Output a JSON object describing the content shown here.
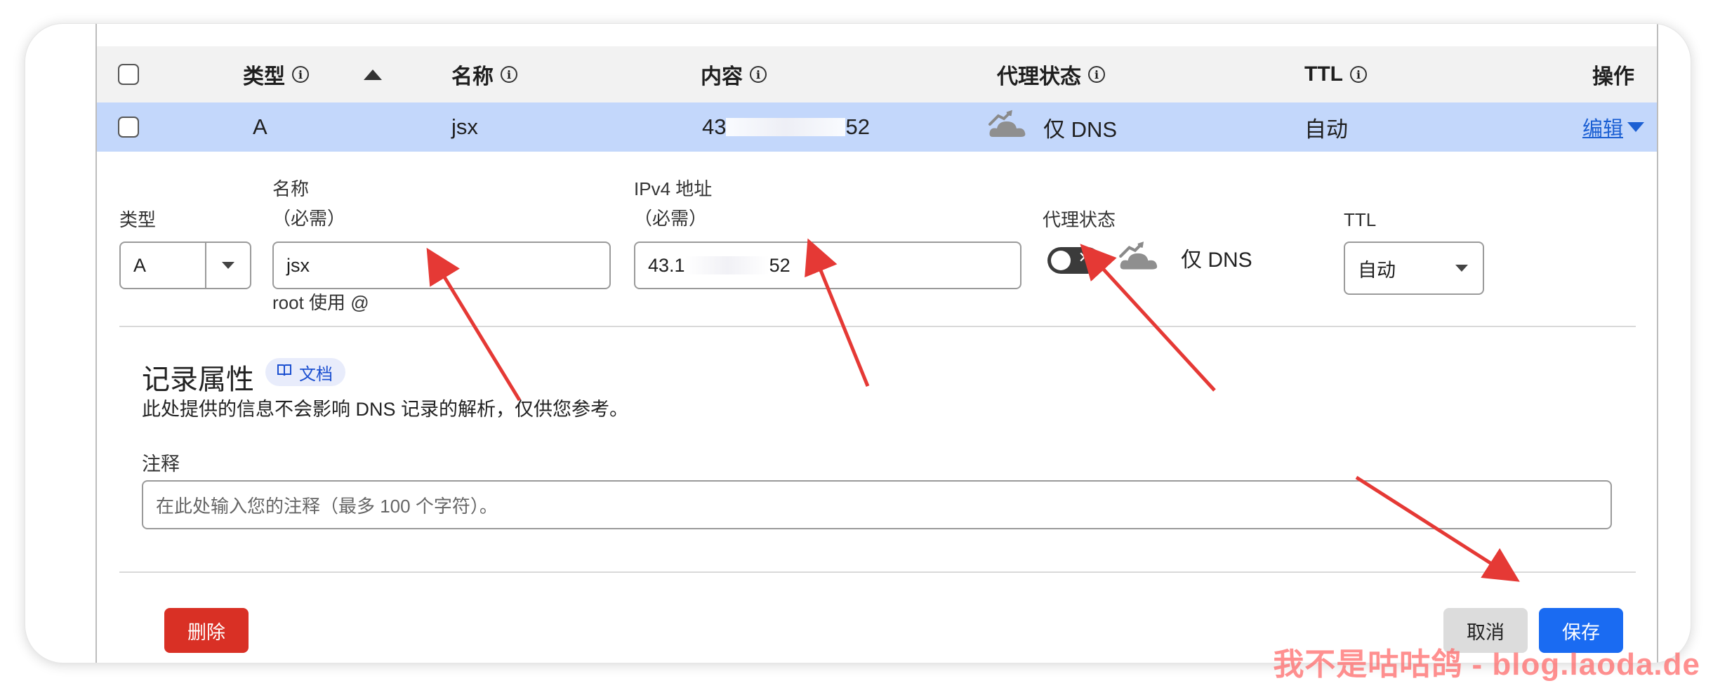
{
  "table": {
    "headers": {
      "type": "类型",
      "name": "名称",
      "content": "内容",
      "proxy": "代理状态",
      "ttl": "TTL",
      "actions": "操作"
    },
    "info_glyph": "i",
    "record": {
      "type": "A",
      "name": "jsx",
      "content_prefix": "43",
      "content_suffix": "52",
      "proxy_status": "仅 DNS",
      "ttl": "自动",
      "edit_label": "编辑"
    }
  },
  "editor": {
    "type_label": "类型",
    "type_value": "A",
    "name_label": "名称",
    "name_required": "（必需）",
    "name_value": "jsx",
    "name_hint": "root 使用 @",
    "ipv4_label": "IPv4 地址",
    "ipv4_required": "（必需）",
    "ipv4_prefix": "43.1",
    "ipv4_suffix": "52",
    "proxy_label": "代理状态",
    "proxy_toggle_on": false,
    "proxy_status": "仅 DNS",
    "ttl_label": "TTL",
    "ttl_value": "自动"
  },
  "record_attributes": {
    "title": "记录属性",
    "doc_badge": "文档",
    "description": "此处提供的信息不会影响 DNS 记录的解析，仅供您参考。",
    "comment_label": "注释",
    "comment_placeholder": "在此处输入您的注释（最多 100 个字符）。"
  },
  "buttons": {
    "delete": "删除",
    "cancel": "取消",
    "save": "保存"
  },
  "watermark": "我不是咕咕鸽 - blog.laoda.de",
  "colors": {
    "selected_row": "#c3d7fb",
    "link": "#1b5fd3",
    "delete": "#d93025",
    "save": "#1a6bf2",
    "annotation_arrow": "#e53935"
  },
  "icons": {
    "cloud": "cloud-icon",
    "doc": "book-icon"
  }
}
